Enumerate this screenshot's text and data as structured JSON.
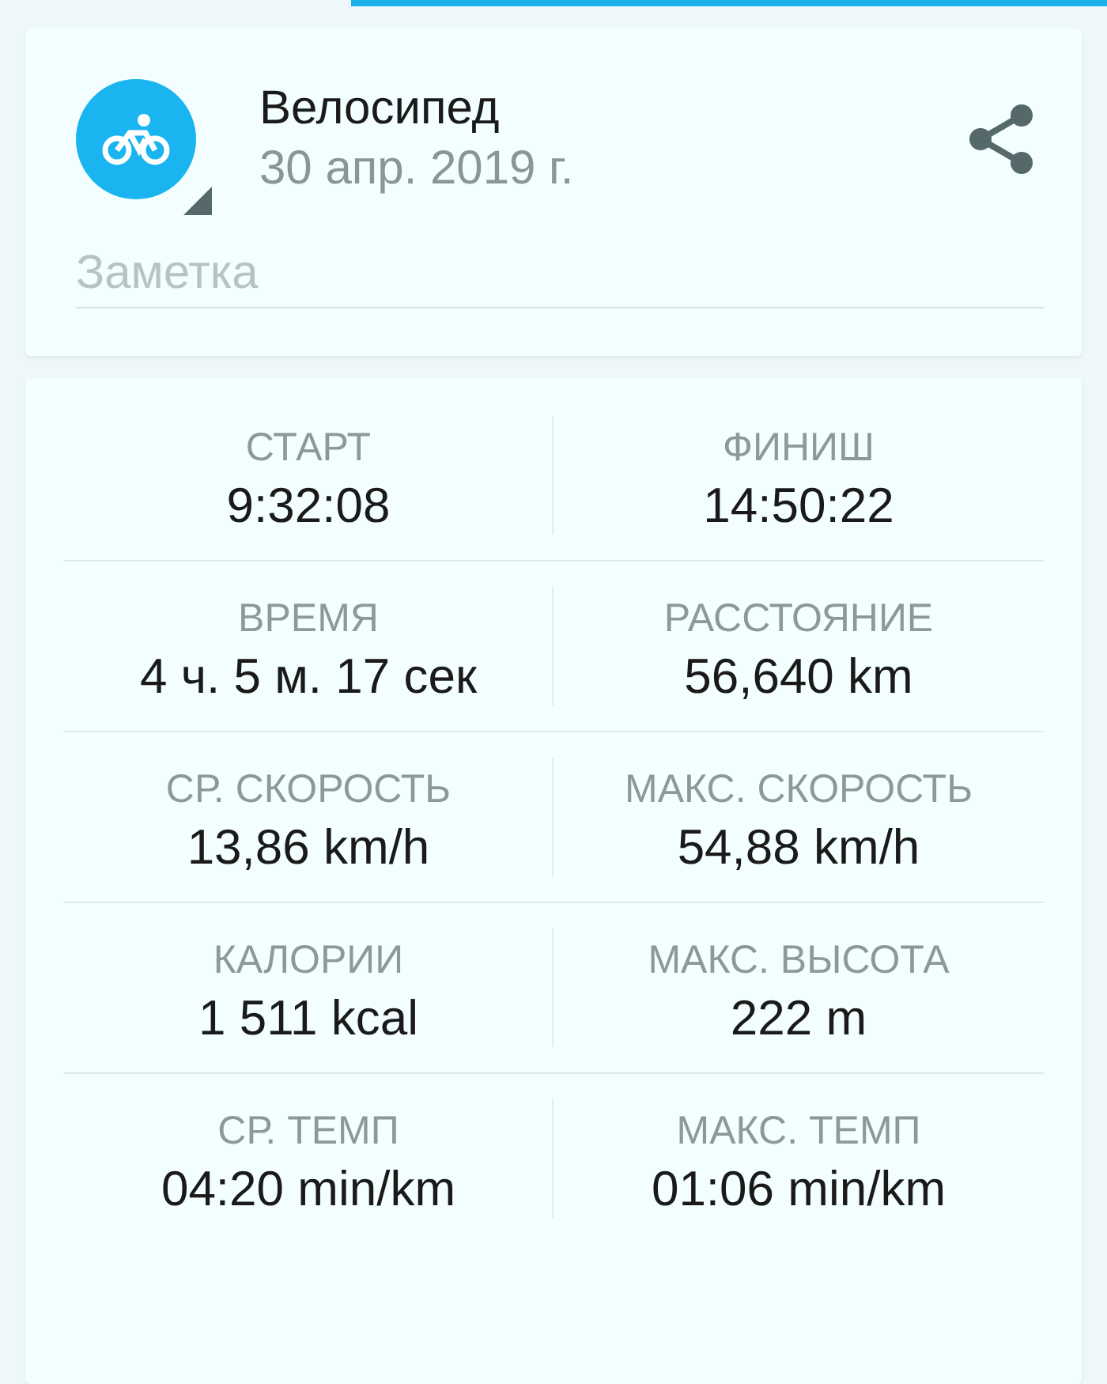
{
  "activity": {
    "title": "Велосипед",
    "date": "30 апр. 2019 г."
  },
  "note": {
    "placeholder": "Заметка"
  },
  "stats": [
    {
      "label": "СТАРТ",
      "value": "9:32:08"
    },
    {
      "label": "ФИНИШ",
      "value": "14:50:22"
    },
    {
      "label": "ВРЕМЯ",
      "value": "4 ч. 5 м. 17 сек"
    },
    {
      "label": "РАССТОЯНИЕ",
      "value": "56,640 km"
    },
    {
      "label": "СР. СКОРОСТЬ",
      "value": "13,86 km/h"
    },
    {
      "label": "МАКС. СКОРОСТЬ",
      "value": "54,88 km/h"
    },
    {
      "label": "КАЛОРИИ",
      "value": "1 511 kcal"
    },
    {
      "label": "МАКС. ВЫСОТА",
      "value": "222 m"
    },
    {
      "label": "СР. ТЕМП",
      "value": "04:20 min/km"
    },
    {
      "label": "МАКС. ТЕМП",
      "value": "01:06 min/km"
    }
  ]
}
